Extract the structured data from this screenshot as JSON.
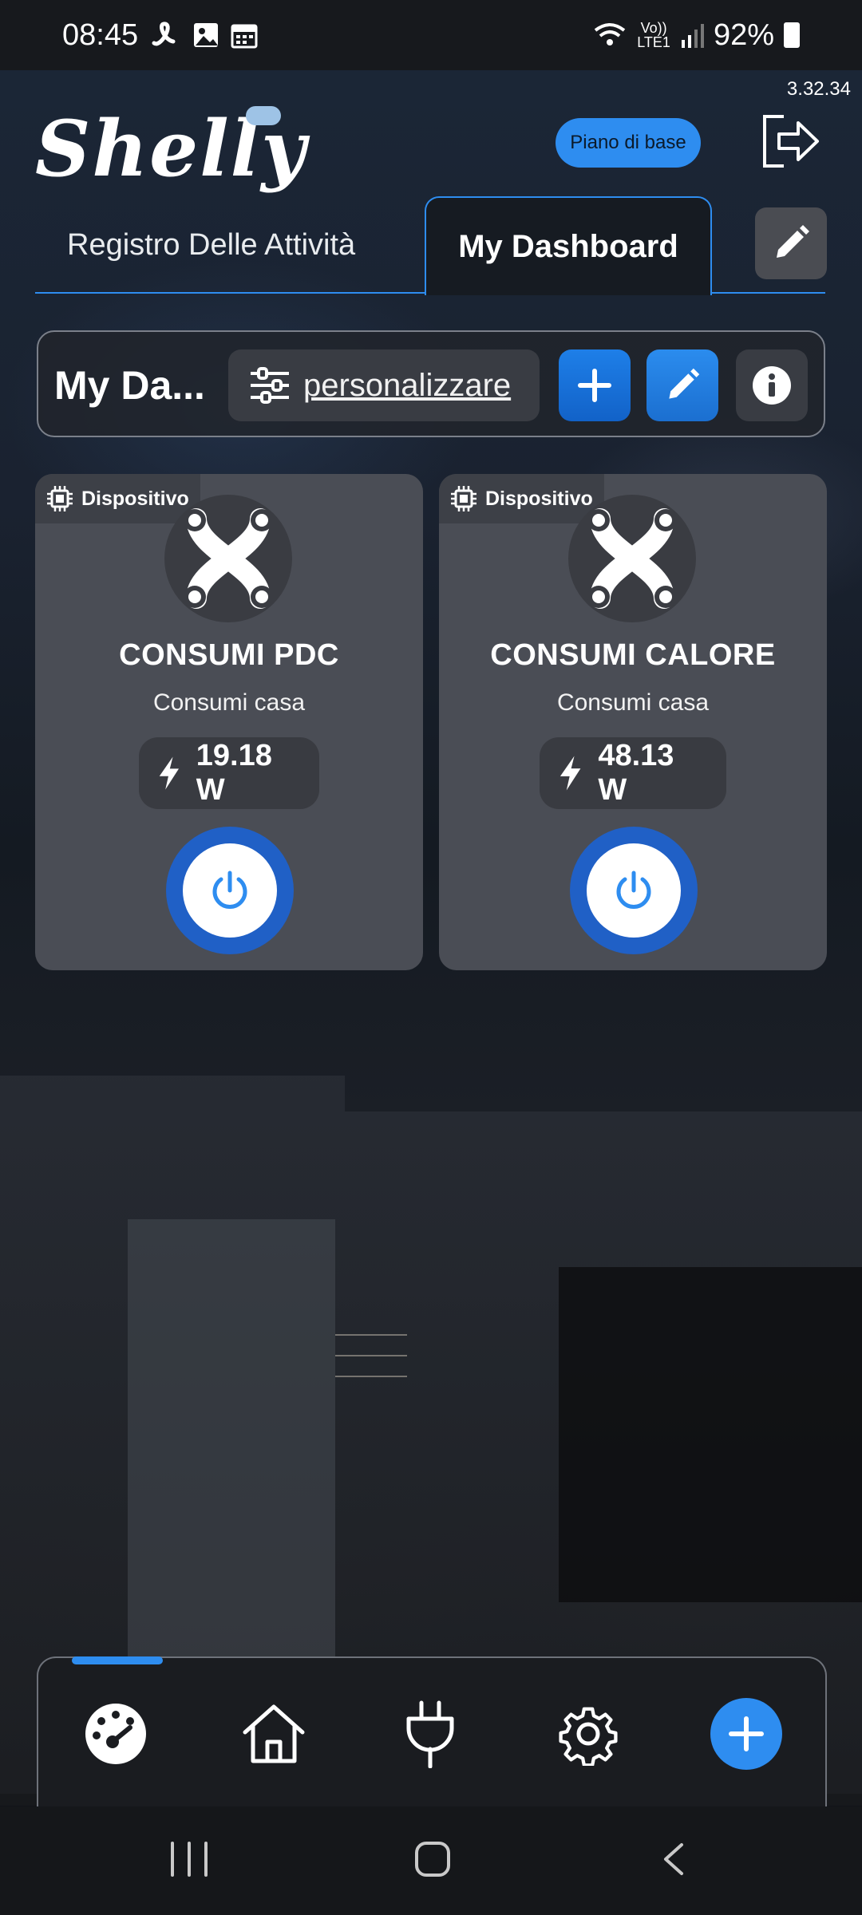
{
  "status_bar": {
    "time": "08:45",
    "battery": "92%",
    "network": "LTE1",
    "volte": "Vo))"
  },
  "app_version": "3.32.34",
  "header": {
    "logo": "Shelly",
    "plan_badge": "Piano di base"
  },
  "tabs": [
    {
      "label": "Registro Delle Attività",
      "active": false
    },
    {
      "label": "My Dashboard",
      "active": true
    }
  ],
  "dashboard_toolbar": {
    "name": "My Da...",
    "customize_label": "personalizzare"
  },
  "cards": [
    {
      "tag": "Dispositivo",
      "title": "CONSUMI PDC",
      "subtitle": "Consumi casa",
      "power": "19.18 W"
    },
    {
      "tag": "Dispositivo",
      "title": "CONSUMI CALORE",
      "subtitle": "Consumi casa",
      "power": "48.13 W"
    }
  ],
  "bottom_nav": {
    "items": [
      "dashboard",
      "home",
      "devices",
      "settings",
      "add"
    ],
    "active_index": 0
  },
  "colors": {
    "accent": "#2e8df0",
    "card_bg": "#4a4d55",
    "power_button": "#2060c6"
  }
}
